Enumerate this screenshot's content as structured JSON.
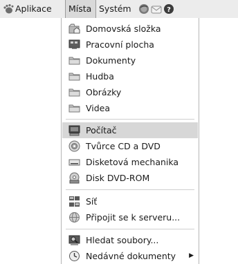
{
  "topbar": {
    "apps_label": "Aplikace",
    "places_label": "Místa",
    "system_label": "Systém",
    "icons": [
      "gnome-foot-icon",
      "web-browser-icon",
      "mail-icon",
      "help-icon"
    ]
  },
  "places_menu": {
    "items_group1": [
      {
        "label": "Domovská složka",
        "icon": "home-folder-icon"
      },
      {
        "label": "Pracovní plocha",
        "icon": "desktop-icon"
      },
      {
        "label": "Dokumenty",
        "icon": "folder-icon"
      },
      {
        "label": "Hudba",
        "icon": "folder-icon"
      },
      {
        "label": "Obrázky",
        "icon": "folder-icon"
      },
      {
        "label": "Videa",
        "icon": "folder-icon"
      }
    ],
    "items_group2": [
      {
        "label": "Počítač",
        "icon": "computer-icon"
      },
      {
        "label": "Tvůrce CD a DVD",
        "icon": "cd-burner-icon"
      },
      {
        "label": "Disketová mechanika",
        "icon": "floppy-drive-icon"
      },
      {
        "label": "Disk DVD-ROM",
        "icon": "dvd-rom-icon"
      }
    ],
    "items_group3": [
      {
        "label": "Síť",
        "icon": "network-icon"
      },
      {
        "label": "Připojit se k serveru...",
        "icon": "connect-server-icon"
      }
    ],
    "items_group4": [
      {
        "label": "Hledat soubory...",
        "icon": "search-files-icon"
      },
      {
        "label": "Nedávné dokumenty",
        "icon": "recent-documents-icon"
      }
    ],
    "submenu_arrow": "▶"
  }
}
